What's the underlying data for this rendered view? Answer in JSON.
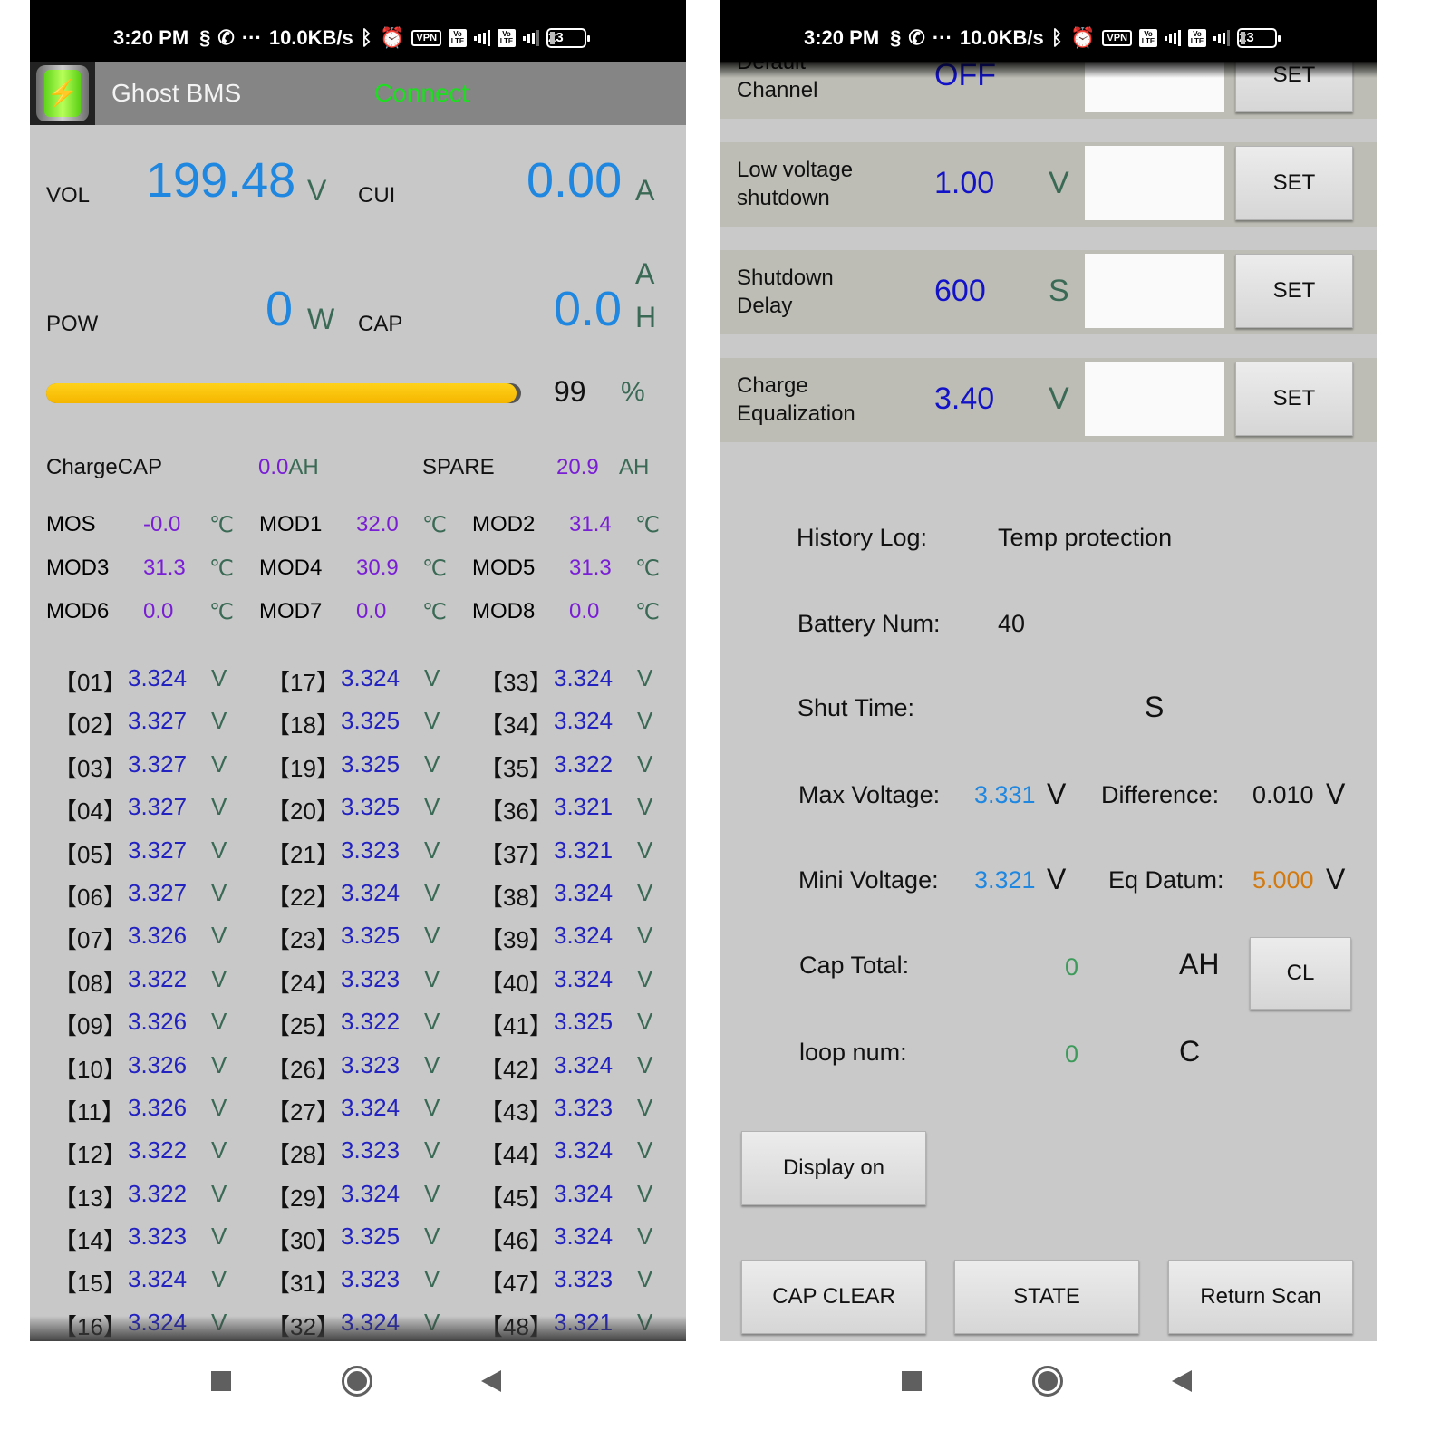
{
  "status_bar": {
    "time": "3:20 PM",
    "net_speed": "10.0KB/s",
    "vpn_label": "VPN",
    "volte_label": "Vo LTE",
    "network_label": "4G",
    "battery_level": "23",
    "icons": [
      "s-pay-icon",
      "whatsapp-icon",
      "more-dots-icon",
      "bluetooth-icon",
      "alarm-icon",
      "vpn-icon",
      "volte-icon",
      "signal-4g-icon",
      "volte-icon",
      "signal-icon",
      "battery-icon"
    ]
  },
  "left_screen": {
    "app_title": "Ghost BMS",
    "connect_label": "Connect",
    "vol": {
      "label": "VOL",
      "value": "199.48",
      "unit": "V"
    },
    "cui": {
      "label": "CUI",
      "value": "0.00",
      "unit": "A"
    },
    "pow": {
      "label": "POW",
      "value": "0",
      "unit": "W"
    },
    "cap": {
      "label": "CAP",
      "value": "0.0",
      "unit_top": "A",
      "unit_bottom": "H"
    },
    "soc": {
      "percent": 99,
      "value": "99",
      "unit": "%"
    },
    "charge_cap": {
      "label": "ChargeCAP",
      "value": "0.0",
      "unit": "AH"
    },
    "spare": {
      "label": "SPARE",
      "value": "20.9",
      "unit": "AH"
    },
    "temp_unit": "℃",
    "temps": [
      [
        {
          "label": "MOS",
          "value": "-0.0"
        },
        {
          "label": "MOD1",
          "value": "32.0"
        },
        {
          "label": "MOD2",
          "value": "31.4"
        }
      ],
      [
        {
          "label": "MOD3",
          "value": "31.3"
        },
        {
          "label": "MOD4",
          "value": "30.9"
        },
        {
          "label": "MOD5",
          "value": "31.3"
        }
      ],
      [
        {
          "label": "MOD6",
          "value": "0.0"
        },
        {
          "label": "MOD7",
          "value": "0.0"
        },
        {
          "label": "MOD8",
          "value": "0.0"
        }
      ]
    ],
    "cell_unit": "V",
    "cells": [
      [
        {
          "idx": "【01】",
          "v": "3.324"
        },
        {
          "idx": "【17】",
          "v": "3.324"
        },
        {
          "idx": "【33】",
          "v": "3.324"
        }
      ],
      [
        {
          "idx": "【02】",
          "v": "3.327"
        },
        {
          "idx": "【18】",
          "v": "3.325"
        },
        {
          "idx": "【34】",
          "v": "3.324"
        }
      ],
      [
        {
          "idx": "【03】",
          "v": "3.327"
        },
        {
          "idx": "【19】",
          "v": "3.325"
        },
        {
          "idx": "【35】",
          "v": "3.322"
        }
      ],
      [
        {
          "idx": "【04】",
          "v": "3.327"
        },
        {
          "idx": "【20】",
          "v": "3.325"
        },
        {
          "idx": "【36】",
          "v": "3.321"
        }
      ],
      [
        {
          "idx": "【05】",
          "v": "3.327"
        },
        {
          "idx": "【21】",
          "v": "3.323"
        },
        {
          "idx": "【37】",
          "v": "3.321"
        }
      ],
      [
        {
          "idx": "【06】",
          "v": "3.327"
        },
        {
          "idx": "【22】",
          "v": "3.324"
        },
        {
          "idx": "【38】",
          "v": "3.324"
        }
      ],
      [
        {
          "idx": "【07】",
          "v": "3.326"
        },
        {
          "idx": "【23】",
          "v": "3.325"
        },
        {
          "idx": "【39】",
          "v": "3.324"
        }
      ],
      [
        {
          "idx": "【08】",
          "v": "3.322"
        },
        {
          "idx": "【24】",
          "v": "3.323"
        },
        {
          "idx": "【40】",
          "v": "3.324"
        }
      ],
      [
        {
          "idx": "【09】",
          "v": "3.326"
        },
        {
          "idx": "【25】",
          "v": "3.322"
        },
        {
          "idx": "【41】",
          "v": "3.325"
        }
      ],
      [
        {
          "idx": "【10】",
          "v": "3.326"
        },
        {
          "idx": "【26】",
          "v": "3.323"
        },
        {
          "idx": "【42】",
          "v": "3.324"
        }
      ],
      [
        {
          "idx": "【11】",
          "v": "3.326"
        },
        {
          "idx": "【27】",
          "v": "3.324"
        },
        {
          "idx": "【43】",
          "v": "3.323"
        }
      ],
      [
        {
          "idx": "【12】",
          "v": "3.322"
        },
        {
          "idx": "【28】",
          "v": "3.323"
        },
        {
          "idx": "【44】",
          "v": "3.324"
        }
      ],
      [
        {
          "idx": "【13】",
          "v": "3.322"
        },
        {
          "idx": "【29】",
          "v": "3.324"
        },
        {
          "idx": "【45】",
          "v": "3.324"
        }
      ],
      [
        {
          "idx": "【14】",
          "v": "3.323"
        },
        {
          "idx": "【30】",
          "v": "3.325"
        },
        {
          "idx": "【46】",
          "v": "3.324"
        }
      ],
      [
        {
          "idx": "【15】",
          "v": "3.324"
        },
        {
          "idx": "【31】",
          "v": "3.323"
        },
        {
          "idx": "【47】",
          "v": "3.323"
        }
      ],
      [
        {
          "idx": "【16】",
          "v": "3.324"
        },
        {
          "idx": "【32】",
          "v": "3.324"
        },
        {
          "idx": "【48】",
          "v": "3.321"
        }
      ]
    ]
  },
  "right_screen": {
    "settings": [
      {
        "label_line1": "Default",
        "label_line2": "Channel",
        "value": "OFF",
        "unit": "",
        "input_value": "",
        "button": "SET"
      },
      {
        "label_line1": "Low voltage",
        "label_line2": "shutdown",
        "value": "1.00",
        "unit": "V",
        "input_value": "",
        "button": "SET"
      },
      {
        "label_line1": "Shutdown",
        "label_line2": "Delay",
        "value": "600",
        "unit": "S",
        "input_value": "",
        "button": "SET"
      },
      {
        "label_line1": "Charge",
        "label_line2": "Equalization",
        "value": "3.40",
        "unit": "V",
        "input_value": "",
        "button": "SET"
      }
    ],
    "history_log": {
      "label": "History   Log:",
      "value": "Temp protection"
    },
    "battery_num": {
      "label": "Battery Num:",
      "value": "40"
    },
    "shut_time": {
      "label": "Shut     Time:",
      "value": "",
      "unit": "S"
    },
    "max_voltage": {
      "label": "Max Voltage:",
      "value": "3.331",
      "unit": "V"
    },
    "difference": {
      "label": "Difference:",
      "value": "0.010",
      "unit": "V"
    },
    "mini_voltage": {
      "label": "Mini Voltage:",
      "value": "3.321",
      "unit": "V"
    },
    "eq_datum": {
      "label": "Eq Datum:",
      "value": "5.000",
      "unit": "V"
    },
    "cap_total": {
      "label": "Cap   Total:",
      "value": "0",
      "unit": "AH",
      "button": "CL"
    },
    "loop_num": {
      "label": "loop   num:",
      "value": "0",
      "unit": "C"
    },
    "buttons": {
      "display_on": "Display on",
      "cap_clear": "CAP CLEAR",
      "state": "STATE",
      "return_scan": "Return Scan"
    }
  }
}
